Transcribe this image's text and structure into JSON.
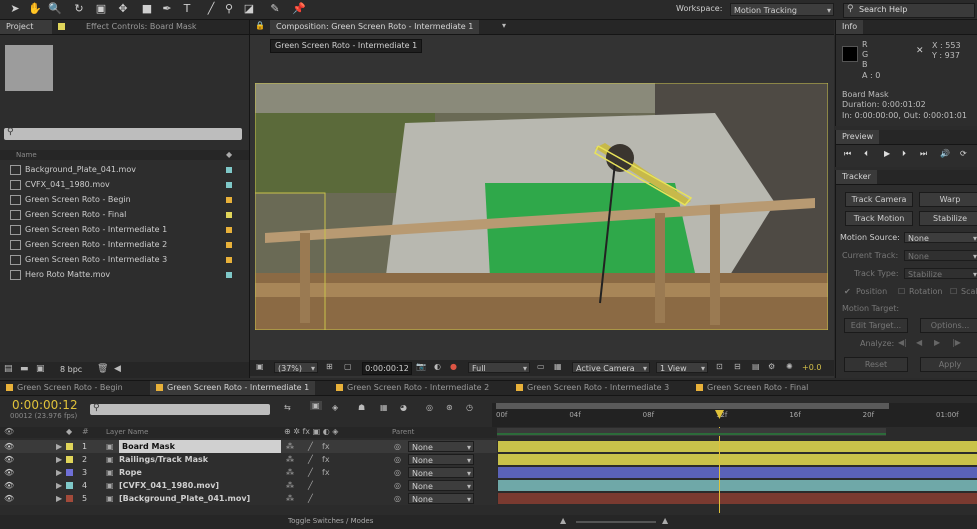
{
  "toolbar": {
    "workspace_label": "Workspace:",
    "workspace_value": "Motion Tracking",
    "search_placeholder": "Search Help"
  },
  "project_panel": {
    "tab_project": "Project",
    "tab_effect_controls": "Effect Controls: Board Mask",
    "column_name": "Name",
    "items": [
      {
        "name": "Background_Plate_041.mov",
        "color": "#7fc8c8"
      },
      {
        "name": "CVFX_041_1980.mov",
        "color": "#7fc8c8"
      },
      {
        "name": "Green Screen Roto - Begin",
        "color": "#e8b13a"
      },
      {
        "name": "Green Screen Roto - Final",
        "color": "#e0d55a"
      },
      {
        "name": "Green Screen Roto - Intermediate 1",
        "color": "#e8b13a"
      },
      {
        "name": "Green Screen Roto - Intermediate 2",
        "color": "#e8b13a"
      },
      {
        "name": "Green Screen Roto - Intermediate 3",
        "color": "#e8b13a"
      },
      {
        "name": "Hero Roto Matte.mov",
        "color": "#7fc8c8"
      }
    ],
    "bpc": "8 bpc"
  },
  "composition": {
    "tab_title": "Composition: Green Screen Roto - Intermediate 1",
    "breadcrumb": "Green Screen Roto - Intermediate 1",
    "zoom": "(37%)",
    "timecode": "0:00:00:12",
    "resolution": "Full",
    "camera": "Active Camera",
    "view_count": "1 View",
    "exposure": "+0.0"
  },
  "info_panel": {
    "tab": "Info",
    "r": "R",
    "g": "G",
    "b": "B",
    "a": "A : 0",
    "x": "X : 553",
    "y": "Y : 937",
    "layer_name": "Board Mask",
    "duration": "Duration: 0:00:01:02",
    "in_out": "In: 0:00:00:00, Out: 0:00:01:01"
  },
  "preview_panel": {
    "tab": "Preview"
  },
  "tracker_panel": {
    "tab": "Tracker",
    "track_camera": "Track Camera",
    "warp_stabilizer": "Warp Stabilizer",
    "track_motion": "Track Motion",
    "stabilize_motion": "Stabilize Motion",
    "motion_source_label": "Motion Source:",
    "motion_source_value": "None",
    "current_track_label": "Current Track:",
    "current_track_value": "None",
    "track_type_label": "Track Type:",
    "track_type_value": "Stabilize",
    "position": "Position",
    "rotation": "Rotation",
    "scale": "Scale",
    "motion_target": "Motion Target:",
    "edit_target": "Edit Target...",
    "options": "Options...",
    "analyze": "Analyze:",
    "reset": "Reset",
    "apply": "Apply"
  },
  "timeline": {
    "tabs": [
      {
        "label": "Green Screen Roto - Begin",
        "color": "#e8b13a"
      },
      {
        "label": "Green Screen Roto - Intermediate 1",
        "color": "#e8b13a"
      },
      {
        "label": "Green Screen Roto - Intermediate 2",
        "color": "#e8b13a"
      },
      {
        "label": "Green Screen Roto - Intermediate 3",
        "color": "#e8b13a"
      },
      {
        "label": "Green Screen Roto - Final",
        "color": "#e8b13a"
      }
    ],
    "current_time": "0:00:00:12",
    "frame_info": "00012 (23.976 fps)",
    "column_layer_name": "Layer Name",
    "column_parent": "Parent",
    "ruler": [
      "00f",
      "04f",
      "08f",
      "12f",
      "16f",
      "20f",
      "01:00f"
    ],
    "layers": [
      {
        "num": "1",
        "name": "Board Mask",
        "color": "#e0d55a",
        "parent": "None",
        "bar": "#c9c24a"
      },
      {
        "num": "2",
        "name": "Railings/Track Mask",
        "color": "#e0d55a",
        "parent": "None",
        "bar": "#c9c24a"
      },
      {
        "num": "3",
        "name": "Rope",
        "color": "#6f6fd6",
        "parent": "None",
        "bar": "#5a62b8"
      },
      {
        "num": "4",
        "name": "[CVFX_041_1980.mov]",
        "color": "#7fc8c8",
        "parent": "None",
        "bar": "#6fa8a8"
      },
      {
        "num": "5",
        "name": "[Background_Plate_041.mov]",
        "color": "#a24a3a",
        "parent": "None",
        "bar": "#7a3a30"
      }
    ],
    "toggle_label": "Toggle Switches / Modes"
  }
}
